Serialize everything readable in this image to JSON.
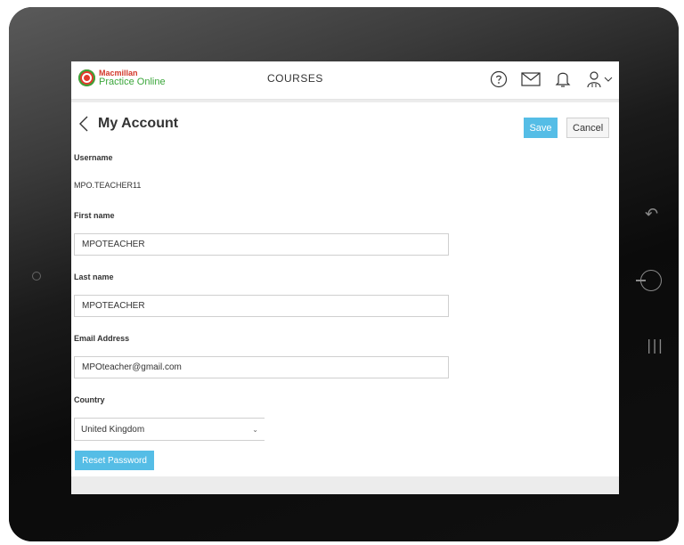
{
  "brand": {
    "line1": "Macmillan",
    "line2": "Practice Online",
    "red": "#e33a2c",
    "green": "#3aa63a"
  },
  "nav": {
    "courses": "COURSES"
  },
  "top_icons": [
    "help-icon",
    "mail-icon",
    "bell-icon",
    "user-icon",
    "chevron-down-icon"
  ],
  "page": {
    "title": "My Account"
  },
  "actions": {
    "save": "Save",
    "cancel": "Cancel",
    "accent": "#55bde6"
  },
  "form": {
    "username_label": "Username",
    "username_value": "MPO.TEACHER11",
    "first_name_label": "First name",
    "first_name_value": "MPOTEACHER",
    "last_name_label": "Last name",
    "last_name_value": "MPOTEACHER",
    "email_label": "Email Address",
    "email_value": "MPOteacher@gmail.com",
    "country_label": "Country",
    "country_value": "United Kingdom",
    "reset_password": "Reset Password"
  },
  "device_buttons": [
    "back-button-icon",
    "home-button-icon",
    "recent-apps-icon"
  ]
}
